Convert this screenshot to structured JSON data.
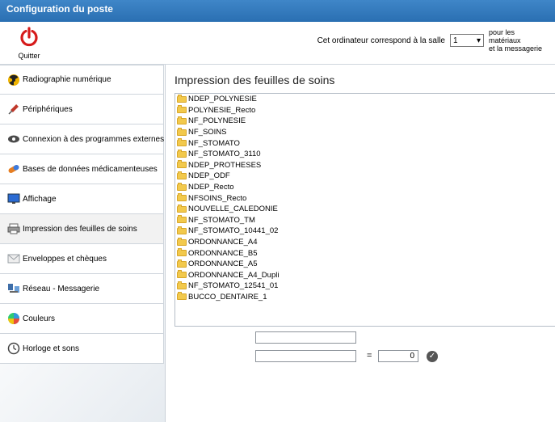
{
  "window": {
    "title": "Configuration du poste"
  },
  "toolbar": {
    "quit_label": "Quitter",
    "room_text": "Cet ordinateur correspond à la salle",
    "room_value": "1",
    "room_after_line1": "pour les matériaux",
    "room_after_line2": "et la messagerie"
  },
  "sidebar": {
    "items": [
      {
        "label": "Radiographie numérique",
        "icon": "radiation-icon",
        "color": "#f0b400"
      },
      {
        "label": "Périphériques",
        "icon": "syringe-icon",
        "color": "#c0392b"
      },
      {
        "label": "Connexion à des programmes externes",
        "icon": "eye-connector-icon",
        "color": "#4a4a4a"
      },
      {
        "label": "Bases de données médicamenteuses",
        "icon": "pill-icon",
        "color": "#e67e22"
      },
      {
        "label": "Affichage",
        "icon": "monitor-icon",
        "color": "#2b6bd3"
      },
      {
        "label": "Impression des feuilles de soins",
        "icon": "printer-icon",
        "color": "#7a7a7a"
      },
      {
        "label": "Enveloppes et chèques",
        "icon": "envelope-icon",
        "color": "#9aa0a6"
      },
      {
        "label": "Réseau - Messagerie",
        "icon": "network-icon",
        "color": "#3f6ea8"
      },
      {
        "label": "Couleurs",
        "icon": "color-wheel-icon",
        "color": "#2ecc71"
      },
      {
        "label": "Horloge et sons",
        "icon": "clock-icon",
        "color": "#444444"
      }
    ],
    "active_index": 5
  },
  "main": {
    "title": "Impression des feuilles de soins",
    "files": [
      "NDEP_POLYNESIE",
      "POLYNESIE_Recto",
      "NF_POLYNESIE",
      "NF_SOINS",
      "NF_STOMATO",
      "NF_STOMATO_3110",
      "NDEP_PROTHESES",
      "NDEP_ODF",
      "NDEP_Recto",
      "NFSOINS_Recto",
      "NOUVELLE_CALEDONIE",
      "NF_STOMATO_TM",
      "NF_STOMATO_10441_02",
      "ORDONNANCE_A4",
      "ORDONNANCE_B5",
      "ORDONNANCE_A5",
      "ORDONNANCE_A4_Dupli",
      "NF_STOMATO_12541_01",
      "BUCCO_DENTAIRE_1"
    ],
    "input1": "",
    "input2": "",
    "equals": "=",
    "number_value": "0"
  }
}
